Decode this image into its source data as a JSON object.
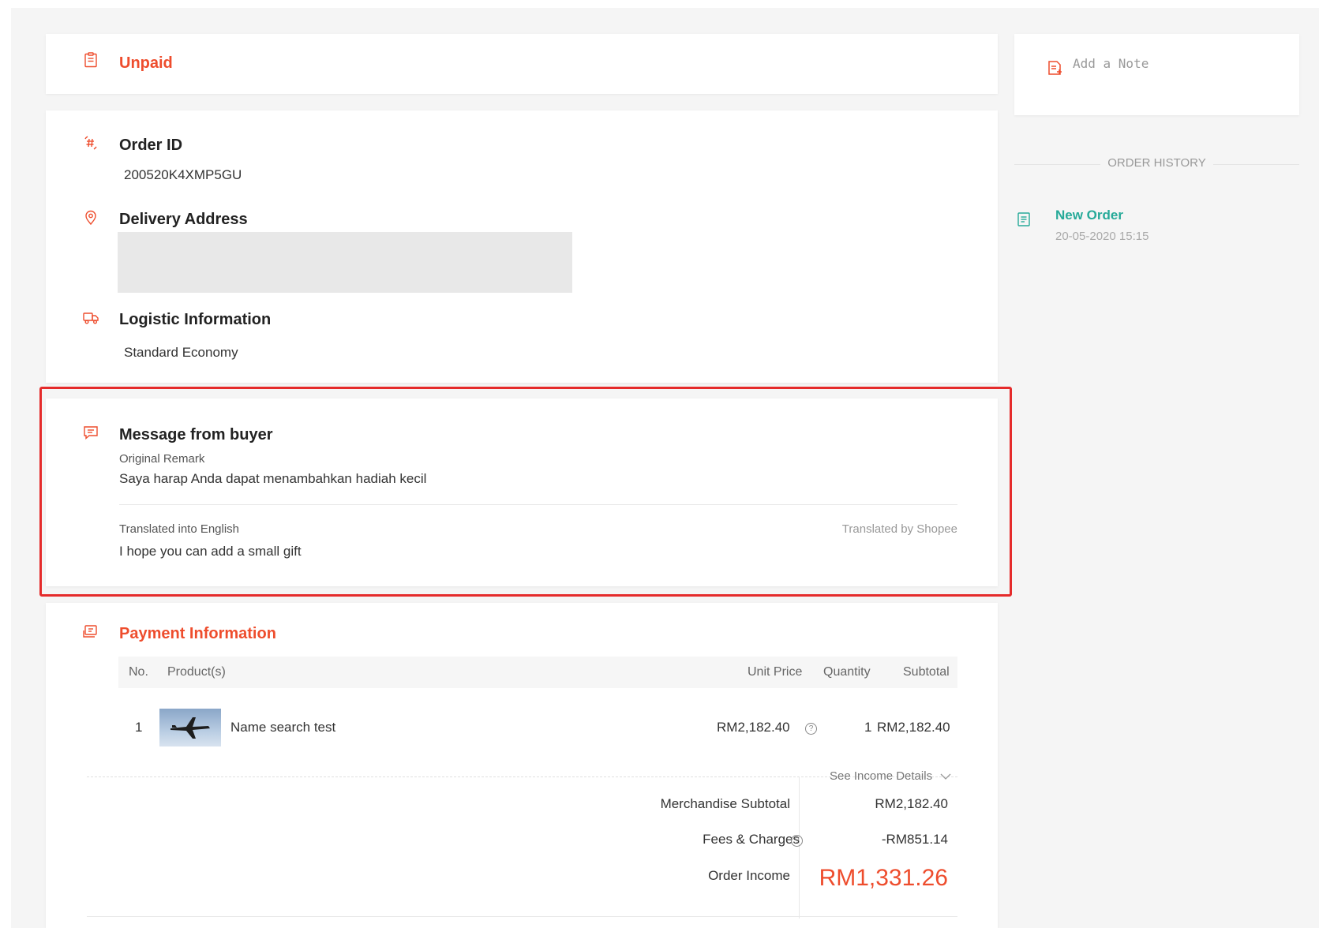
{
  "status": {
    "label": "Unpaid",
    "color": "#ee4d2d",
    "icon": "clipboard-icon"
  },
  "details": {
    "order_id": {
      "label": "Order ID",
      "value": "200520K4XMP5GU",
      "icon": "hash-icon"
    },
    "delivery_address": {
      "label": "Delivery Address",
      "icon": "location-pin-icon"
    },
    "logistic": {
      "label": "Logistic Information",
      "value": "Standard Economy",
      "icon": "truck-icon"
    }
  },
  "message": {
    "title": "Message from buyer",
    "icon": "chat-bubble-icon",
    "original_label": "Original Remark",
    "original_text": "Saya harap Anda dapat menambahkan hadiah kecil",
    "translated_label": "Translated into English",
    "translated_by": "Translated by Shopee",
    "translated_text": "I hope you can add a small gift",
    "highlight_color": "#e52b2b"
  },
  "payment": {
    "title": "Payment Information",
    "icon": "payment-icon",
    "columns": {
      "no": "No.",
      "product": "Product(s)",
      "unit_price": "Unit Price",
      "quantity": "Quantity",
      "subtotal": "Subtotal"
    },
    "rows": [
      {
        "no": "1",
        "product": "Name search test",
        "unit_price": "RM2,182.40",
        "quantity": "1",
        "subtotal": "RM2,182.40"
      }
    ],
    "see_income_details": "See Income Details",
    "summary": {
      "merch_label": "Merchandise Subtotal",
      "merch_value": "RM2,182.40",
      "fees_label": "Fees & Charges",
      "fees_value": "-RM851.14",
      "income_label": "Order Income",
      "income_value": "RM1,331.26"
    }
  },
  "side": {
    "note_placeholder": "Add a Note",
    "history_title": "ORDER HISTORY",
    "events": [
      {
        "title": "New Order",
        "time": "20-05-2020 15:15",
        "color": "#26aa99"
      }
    ]
  }
}
